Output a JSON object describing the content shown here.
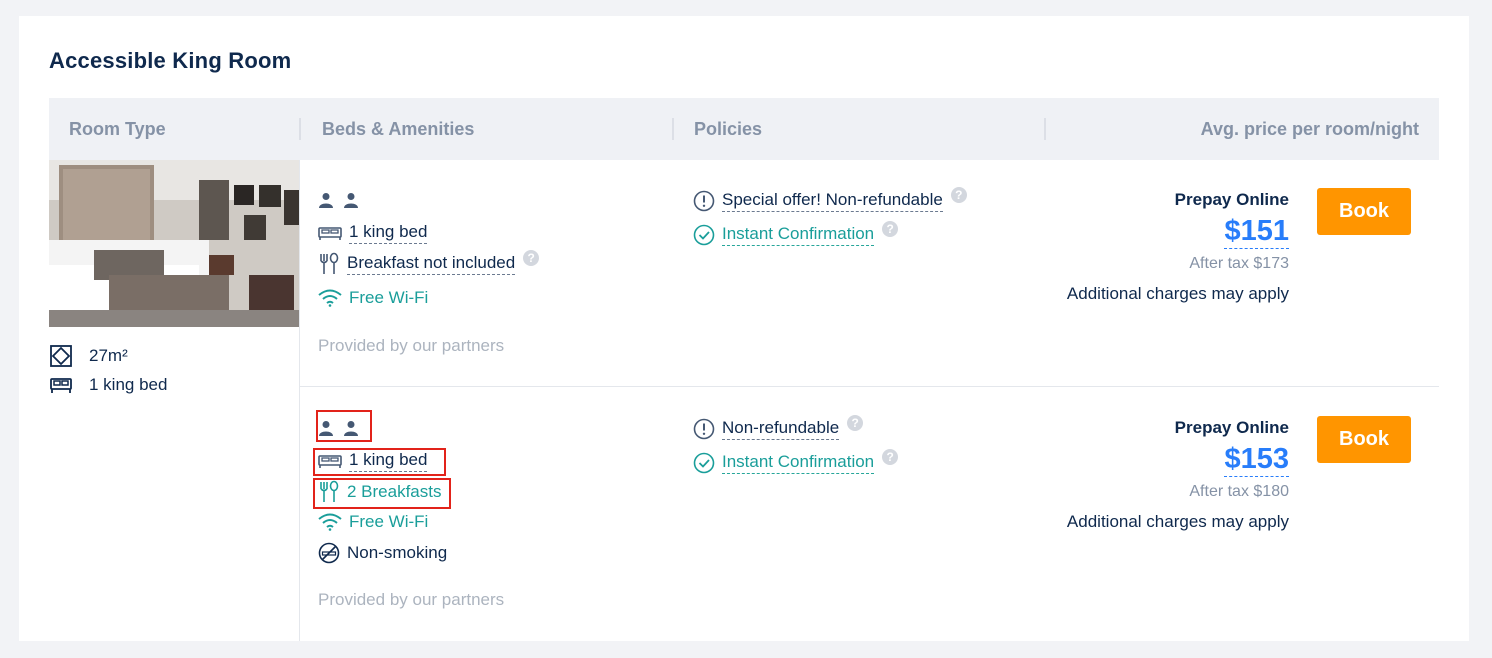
{
  "room": {
    "title": "Accessible King Room",
    "size": "27m²",
    "bed_summary": "1 king bed"
  },
  "table_headers": {
    "room_type": "Room Type",
    "beds_amenities": "Beds & Amenities",
    "policies": "Policies",
    "avg_price": "Avg. price per room/night"
  },
  "offers": [
    {
      "bed": "1 king bed",
      "meal": "Breakfast not included",
      "wifi": "Free Wi-Fi",
      "provided_by": "Provided by our partners",
      "policy_refund": "Special offer! Non-refundable",
      "policy_confirm": "Instant Confirmation",
      "payment": "Prepay Online",
      "price": "$151",
      "after_tax": "After tax $173",
      "note": "Additional charges may apply",
      "book_label": "Book"
    },
    {
      "bed": "1 king bed",
      "meal": "2 Breakfasts",
      "wifi": "Free Wi-Fi",
      "smoking": "Non-smoking",
      "provided_by": "Provided by our partners",
      "policy_refund": "Non-refundable",
      "policy_confirm": "Instant Confirmation",
      "payment": "Prepay Online",
      "price": "$153",
      "after_tax": "After tax $180",
      "note": "Additional charges may apply",
      "book_label": "Book"
    }
  ],
  "colors": {
    "title": "#0f294d",
    "accent_price": "#287dfa",
    "book_button": "#ff9500",
    "amenity_green": "#1a9e9a",
    "highlight_box": "#e2231a"
  }
}
